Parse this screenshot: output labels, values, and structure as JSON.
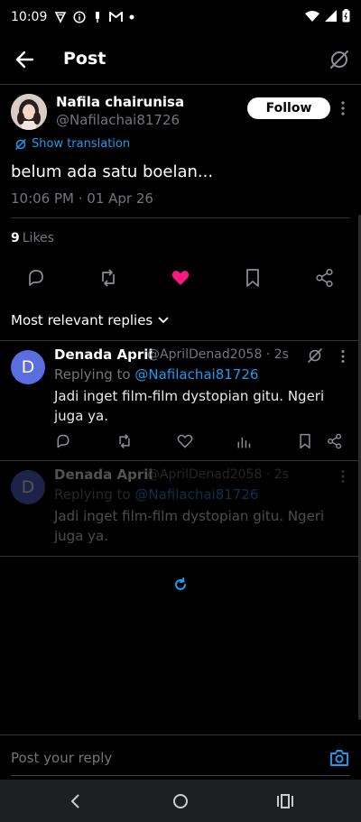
{
  "status_bar": {
    "time": "10:09",
    "left_icons": [
      "vpn-icon",
      "info-icon",
      "usb-debug-icon",
      "gmail-icon",
      "dot-icon"
    ],
    "right_icons": [
      "wifi-icon",
      "signal-icon",
      "battery-icon"
    ]
  },
  "header": {
    "title": "Post"
  },
  "post": {
    "author_name": "Nafila chairunisa",
    "author_handle": "@Nafilachai81726",
    "follow_label": "Follow",
    "translation_label": "Show translation",
    "text": "belum ada satu boelan...",
    "timestamp": "10:06 PM · 01 Apr 26",
    "likes_count": "9",
    "likes_label": "Likes",
    "liked": true
  },
  "replies_filter": {
    "label": "Most relevant replies"
  },
  "replies": [
    {
      "avatar_letter": "D",
      "name": "Denada April",
      "handle": "@AprilDenad2058 · 2s",
      "replying_prefix": "Replying to",
      "replying_to": "@Nafilachai81726",
      "text": "Jadi inget film-film dystopian gitu. Ngeri juga ya."
    },
    {
      "avatar_letter": "D",
      "name": "Denada April",
      "handle": "@AprilDenad2058 · 2s",
      "replying_prefix": "Replying to",
      "replying_to": "@Nafilachai81726",
      "text": "Jadi inget film-film dystopian gitu. Ngeri juga ya."
    }
  ],
  "composer": {
    "placeholder": "Post your reply"
  },
  "colors": {
    "accent": "#1d9bf0",
    "like": "#f91880",
    "background": "#000000",
    "muted": "#71767b"
  }
}
